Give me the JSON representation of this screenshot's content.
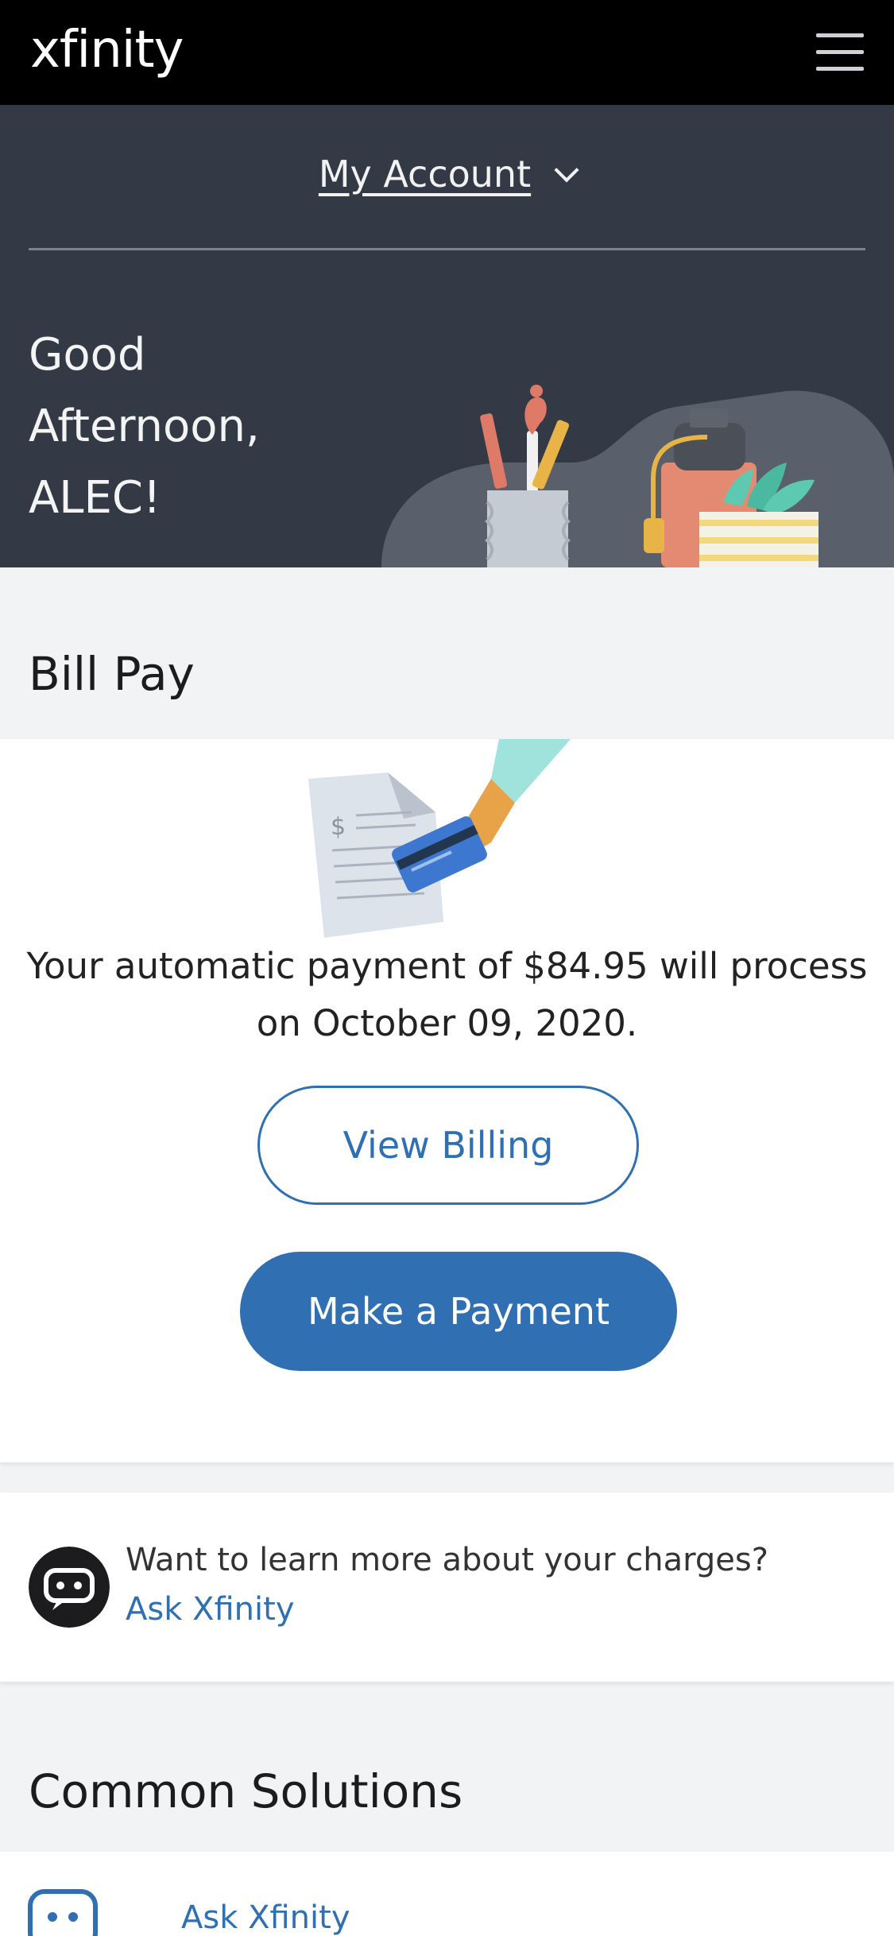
{
  "header": {
    "brand": "xfinity",
    "menu_icon": "hamburger-menu-icon"
  },
  "hero": {
    "account_label": "My Account",
    "chevron_icon": "chevron-down-icon",
    "greeting_line1": "Good",
    "greeting_line2": "Afternoon,",
    "greeting_line3": "ALEC!",
    "colors": {
      "background": "#343a45",
      "divider": "#7d838c"
    }
  },
  "bill_pay": {
    "title": "Bill Pay",
    "message": "Your automatic payment of $84.95 will process on October 09, 2020.",
    "view_billing_label": "View Billing",
    "make_payment_label": "Make a Payment",
    "illustration_glyph": "$"
  },
  "ask": {
    "question": "Want to learn more about your charges?",
    "link_label": "Ask Xfinity",
    "icon": "chat-bubble-icon"
  },
  "common_solutions": {
    "title": "Common Solutions",
    "items": [
      {
        "label": "Ask Xfinity",
        "icon": "chat-icon"
      }
    ]
  },
  "colors": {
    "accent": "#2f6fb2",
    "topbar": "#000000",
    "page_bg": "#f2f3f5"
  }
}
